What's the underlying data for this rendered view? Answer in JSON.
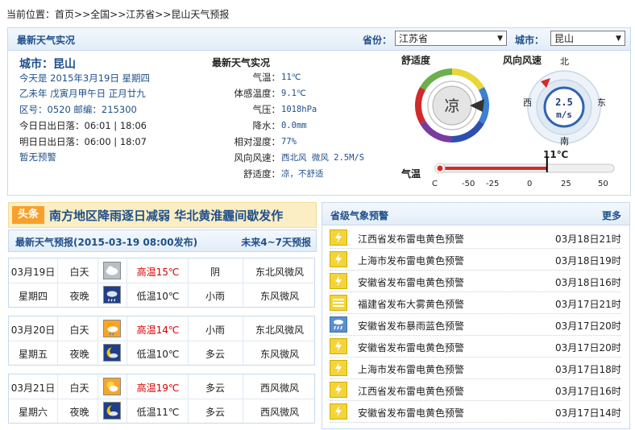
{
  "breadcrumb": {
    "prefix": "当前位置：",
    "items": [
      "首页",
      "全国",
      "江苏省",
      "昆山天气预报"
    ],
    "sep": ">>"
  },
  "observation": {
    "title": "最新天气实况",
    "province_label": "省份：",
    "province_value": "江苏省",
    "city_label": "城市：",
    "city_value": "昆山"
  },
  "city_info": {
    "name": "城市：昆山",
    "today": "今天是 2015年3月19日 星期四",
    "lunar": "乙未年 戊寅月甲午日 正月廿九",
    "codes": "区号：0520  邮编：215300",
    "sun_today": "今日日出日落：06:01 | 18:06",
    "sun_tomorrow": "明日日出日落：06:00 | 18:07",
    "warning": "暂无预警"
  },
  "live": {
    "title": "最新天气实况",
    "rows": [
      {
        "k": "气温：",
        "v": "11℃"
      },
      {
        "k": "体感温度：",
        "v": "9.1℃"
      },
      {
        "k": "气压：",
        "v": "1018hPa"
      },
      {
        "k": "降水：",
        "v": "0.0mm"
      },
      {
        "k": "相对湿度：",
        "v": "77%"
      },
      {
        "k": "风向风速：",
        "v": "西北风 微风 2.5M/S"
      },
      {
        "k": "舒适度：",
        "v": "凉，不舒适"
      }
    ]
  },
  "comfort": {
    "title": "舒适度",
    "value": "凉"
  },
  "wind": {
    "title": "风向风速",
    "speed": "2.5",
    "unit": "m/s",
    "n": "北",
    "s": "南",
    "w": "西",
    "e": "东"
  },
  "temp_bar": {
    "label": "气温",
    "value_label": "11℃",
    "value": 11,
    "min": -60,
    "max": 60,
    "ticks": [
      "C",
      "-50",
      "-25",
      "0",
      "25",
      "50"
    ]
  },
  "headline": {
    "tag": "头条",
    "text": "南方地区降雨逐日减弱 华北黄淮霾间歇发作"
  },
  "forecast": {
    "title": "最新天气预报(2015-03-19 08:00发布)",
    "more": "未来4~7天预报",
    "days": [
      {
        "date": "03月19日",
        "week": "星期四",
        "day": {
          "period": "白天",
          "icon": "cloudy-icon",
          "temp": "高温15℃",
          "weather": "阴",
          "wind": "东北风微风"
        },
        "night": {
          "period": "夜晚",
          "icon": "rain-night-icon",
          "temp": "低温10℃",
          "weather": "小雨",
          "wind": "东风微风"
        }
      },
      {
        "date": "03月20日",
        "week": "星期五",
        "day": {
          "period": "白天",
          "icon": "rain-day-icon",
          "temp": "高温14℃",
          "weather": "小雨",
          "wind": "东北风微风"
        },
        "night": {
          "period": "夜晚",
          "icon": "cloudy-night-icon",
          "temp": "低温10℃",
          "weather": "多云",
          "wind": "东风微风"
        }
      },
      {
        "date": "03月21日",
        "week": "星期六",
        "day": {
          "period": "白天",
          "icon": "partly-cloudy-icon",
          "temp": "高温19℃",
          "weather": "多云",
          "wind": "西风微风"
        },
        "night": {
          "period": "夜晚",
          "icon": "cloudy-night-icon",
          "temp": "低温11℃",
          "weather": "多云",
          "wind": "西风微风"
        }
      }
    ]
  },
  "alerts": {
    "title": "省级气象预警",
    "more": "更多",
    "items": [
      {
        "text": "江西省发布雷电黄色预警",
        "date": "03月18日21时",
        "icon": "lightning-yellow-icon"
      },
      {
        "text": "上海市发布雷电黄色预警",
        "date": "03月18日19时",
        "icon": "lightning-yellow-icon"
      },
      {
        "text": "安徽省发布雷电黄色预警",
        "date": "03月18日16时",
        "icon": "lightning-yellow-icon"
      },
      {
        "text": "福建省发布大雾黄色预警",
        "date": "03月17日21时",
        "icon": "fog-yellow-icon"
      },
      {
        "text": "安徽省发布暴雨蓝色预警",
        "date": "03月17日20时",
        "icon": "rainstorm-blue-icon"
      },
      {
        "text": "安徽省发布雷电黄色预警",
        "date": "03月17日20时",
        "icon": "lightning-yellow-icon"
      },
      {
        "text": "上海市发布雷电黄色预警",
        "date": "03月17日18时",
        "icon": "lightning-yellow-icon"
      },
      {
        "text": "江西省发布雷电黄色预警",
        "date": "03月17日16时",
        "icon": "lightning-yellow-icon"
      },
      {
        "text": "安徽省发布雷电黄色预警",
        "date": "03月17日14时",
        "icon": "lightning-yellow-icon"
      }
    ]
  }
}
